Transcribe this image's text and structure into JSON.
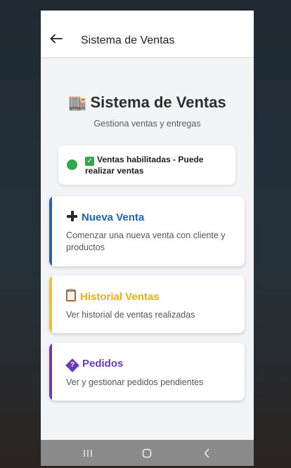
{
  "appbar": {
    "title": "Sistema de Ventas"
  },
  "header": {
    "title": "Sistema de Ventas",
    "title_icon": "department-store-emoji",
    "title_emoji": "🏬",
    "subtitle": "Gestiona ventas y entregas"
  },
  "status": {
    "indicator_color": "#2eaa4a",
    "check_icon": "check-mark-button-emoji",
    "text": "Ventas habilitadas - Puede realizar ventas"
  },
  "menu": {
    "items": [
      {
        "icon": "plus-icon",
        "title": "Nueva Venta",
        "description": "Comenzar una nueva venta con cliente y productos",
        "accent_color": "#1d64c0"
      },
      {
        "icon": "clipboard-icon",
        "title": "Historial Ventas",
        "description": "Ver historial de ventas realizadas",
        "accent_color": "#f1c21a"
      },
      {
        "icon": "unknown-glyph-icon",
        "icon_glyph": "?",
        "title": "Pedidos",
        "description": "Ver y gestionar pedidos pendientes",
        "accent_color": "#6a3ab8"
      }
    ]
  },
  "system_nav": {
    "recents_icon": "recents-icon",
    "home_icon": "home-icon",
    "back_icon": "back-chevron-icon"
  }
}
